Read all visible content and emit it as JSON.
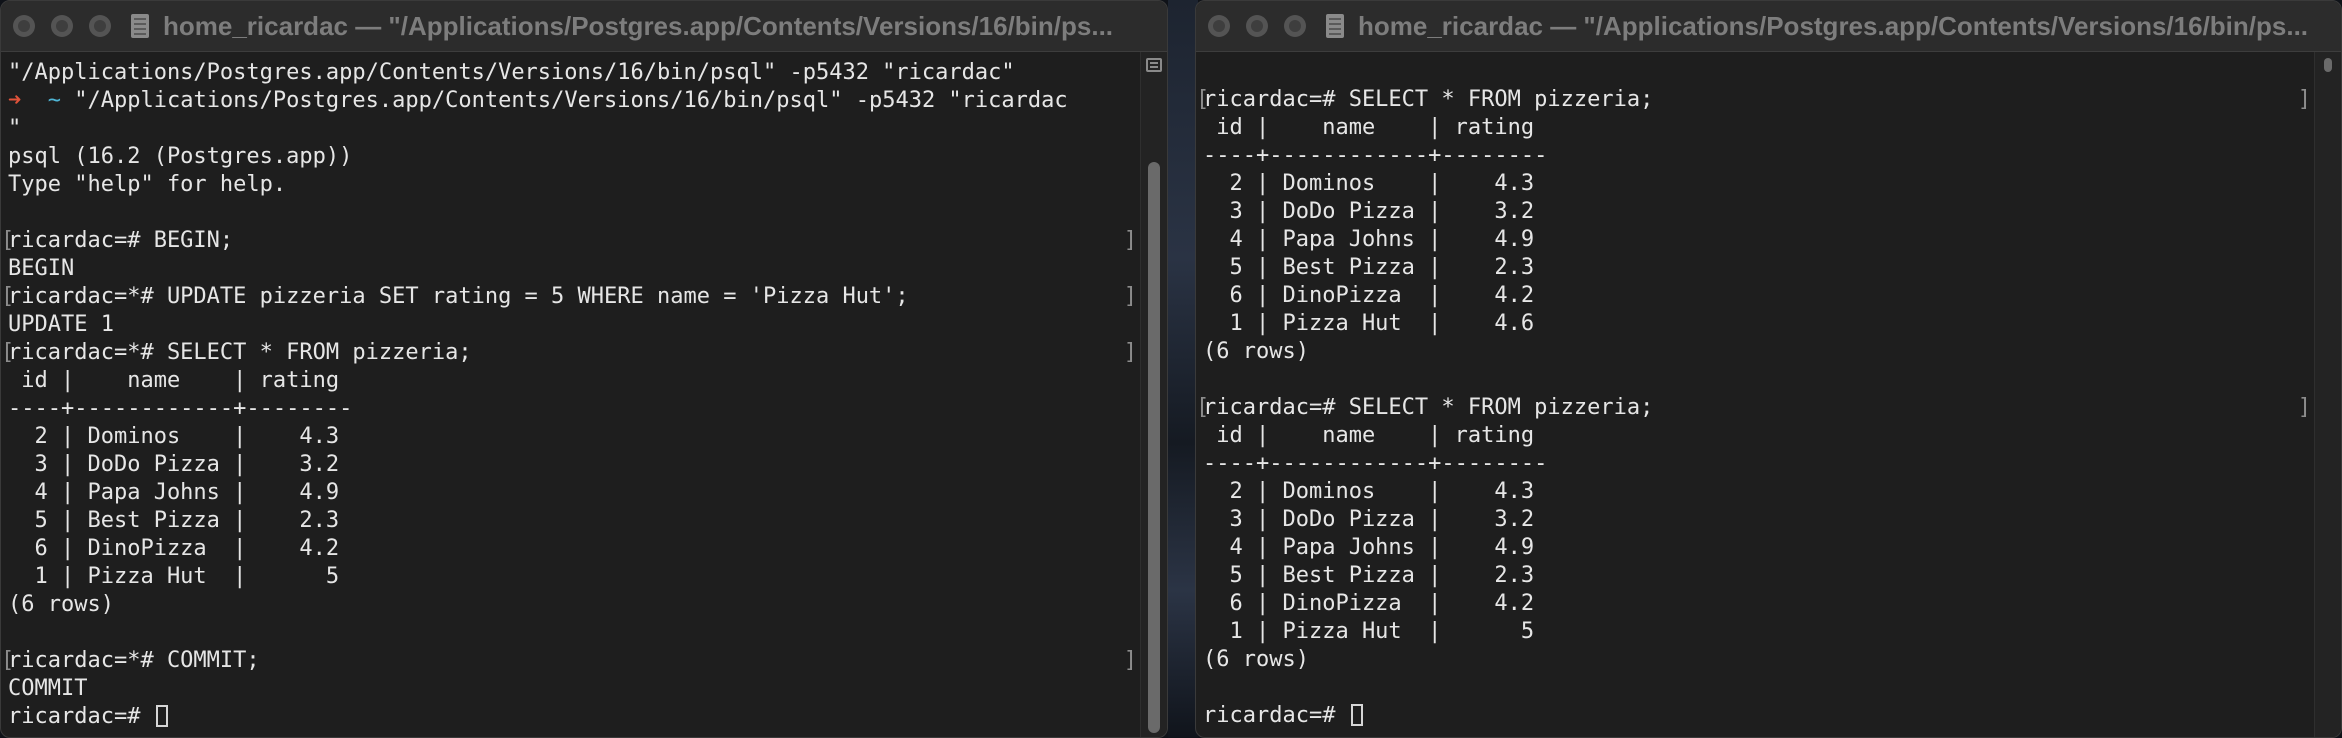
{
  "left_window": {
    "title": "home_ricardac — \"/Applications/Postgres.app/Contents/Versions/16/bin/ps...",
    "lines": [
      "\"/Applications/Postgres.app/Contents/Versions/16/bin/psql\" -p5432 \"ricardac\"",
      "\"/Applications/Postgres.app/Contents/Versions/16/bin/psql\" -p5432 \"ricardac",
      "\"",
      "psql (16.2 (Postgres.app))",
      "Type \"help\" for help.",
      "",
      "ricardac=# BEGIN;",
      "BEGIN",
      "ricardac=*# UPDATE pizzeria SET rating = 5 WHERE name = 'Pizza Hut';",
      "UPDATE 1",
      "ricardac=*# SELECT * FROM pizzeria;",
      " id |    name    | rating",
      "----+------------+--------",
      "  2 | Dominos    |    4.3",
      "  3 | DoDo Pizza |    3.2",
      "  4 | Papa Johns |    4.9",
      "  5 | Best Pizza |    2.3",
      "  6 | DinoPizza  |    4.2",
      "  1 | Pizza Hut  |      5",
      "(6 rows)",
      "",
      "ricardac=*# COMMIT;",
      "COMMIT",
      "ricardac=# "
    ],
    "prompt_arrow": "➜",
    "prompt_tilde": "~"
  },
  "right_window": {
    "title": "home_ricardac — \"/Applications/Postgres.app/Contents/Versions/16/bin/ps...",
    "lines": [
      "",
      "ricardac=# SELECT * FROM pizzeria;",
      " id |    name    | rating",
      "----+------------+--------",
      "  2 | Dominos    |    4.3",
      "  3 | DoDo Pizza |    3.2",
      "  4 | Papa Johns |    4.9",
      "  5 | Best Pizza |    2.3",
      "  6 | DinoPizza  |    4.2",
      "  1 | Pizza Hut  |    4.6",
      "(6 rows)",
      "",
      "ricardac=# SELECT * FROM pizzeria;",
      " id |    name    | rating",
      "----+------------+--------",
      "  2 | Dominos    |    4.3",
      "  3 | DoDo Pizza |    3.2",
      "  4 | Papa Johns |    4.9",
      "  5 | Best Pizza |    2.3",
      "  6 | DinoPizza  |    4.2",
      "  1 | Pizza Hut  |      5",
      "(6 rows)",
      "",
      "ricardac=# "
    ]
  },
  "icons": {
    "close": "close-icon",
    "minimize": "minimize-icon",
    "zoom": "zoom-icon",
    "document": "document-icon",
    "cursor": "text-cursor-icon"
  },
  "colors": {
    "background": "#1e1e1e",
    "text": "#e6e6e6",
    "titlebar": "#2c2c2c",
    "title_text": "#7d7d7d",
    "prompt_arrow": "#e0533a",
    "prompt_tilde": "#4fb6d6"
  }
}
